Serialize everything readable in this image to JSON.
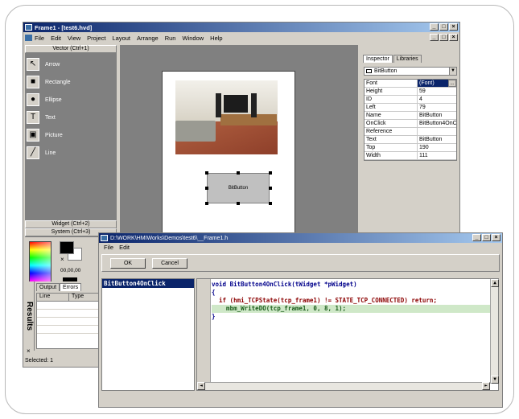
{
  "main_window": {
    "title": "Frame1 - [test6.hvd]",
    "menu": [
      "File",
      "Edit",
      "View",
      "Project",
      "Layout",
      "Arrange",
      "Run",
      "Window",
      "Help"
    ],
    "btn_min": "_",
    "btn_max": "□",
    "btn_close": "×",
    "mdi_min": "_",
    "mdi_restore": "□",
    "mdi_close": "×"
  },
  "toolbox": {
    "vector_header": "Vector (Ctrl+1)",
    "tools": [
      {
        "label": "Arrow",
        "icon": "arrow-icon",
        "glyph": "↖"
      },
      {
        "label": "Rectangle",
        "icon": "rectangle-icon",
        "glyph": "■"
      },
      {
        "label": "Ellipse",
        "icon": "ellipse-icon",
        "glyph": "●"
      },
      {
        "label": "Text",
        "icon": "text-icon",
        "glyph": "T"
      },
      {
        "label": "Picture",
        "icon": "picture-icon",
        "glyph": "▣"
      },
      {
        "label": "Line",
        "icon": "line-icon",
        "glyph": "╱"
      }
    ],
    "widget_header": "Widget (Ctrl+2)",
    "system_header": "System (Ctrl+3)",
    "rgb_value": "00,00,00",
    "swatch_x": "×"
  },
  "results": {
    "label": "Results",
    "tabs": [
      "Output",
      "Errors"
    ],
    "columns": [
      "Line",
      "Type"
    ],
    "close": "×"
  },
  "status": "Selected: 1",
  "canvas": {
    "widget_label": "BitButton"
  },
  "inspector": {
    "tabs": [
      "Inspector",
      "Libraries"
    ],
    "selected_object": "BitButton",
    "dropdown_glyph": "▼",
    "ellipsis": "...",
    "properties": [
      {
        "key": "Font",
        "value": "(Font)"
      },
      {
        "key": "Height",
        "value": "59"
      },
      {
        "key": "ID",
        "value": "4"
      },
      {
        "key": "Left",
        "value": "79"
      },
      {
        "key": "Name",
        "value": "BitButton"
      },
      {
        "key": "OnClick",
        "value": "BitButton4OnClick"
      },
      {
        "key": "Reference",
        "value": ""
      },
      {
        "key": "Text",
        "value": "BitButton"
      },
      {
        "key": "Top",
        "value": "190"
      },
      {
        "key": "Width",
        "value": "111"
      }
    ]
  },
  "editor": {
    "title": "D:\\WORK\\HMIWorks\\Demos\\test6\\__Frame1.h",
    "menu": [
      "File",
      "Edit"
    ],
    "ok_label": "OK",
    "cancel_label": "Cancel",
    "functions": [
      "BitButton4OnClick"
    ],
    "code_lines": [
      "void BitButton4OnClick(tWidget *pWidget)",
      "{",
      "  if (hmi_TCPState(tcp_frame1) != STATE_TCP_CONNECTED) return;",
      "    mbm_WriteDO(tcp_frame1, 0, 8, 1);",
      "}"
    ],
    "scroll_up": "▲",
    "scroll_down": "▼",
    "scroll_left": "◄",
    "scroll_right": "►",
    "btn_min": "_",
    "btn_max": "□",
    "btn_close": "×"
  }
}
